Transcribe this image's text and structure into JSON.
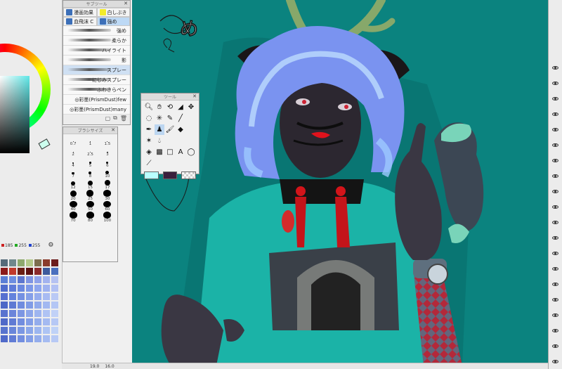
{
  "color_panel": {
    "rgb": {
      "r": "185",
      "g": "255",
      "b": "255"
    },
    "rgb_colors": {
      "r": "#cc2222",
      "g": "#22aa22",
      "b": "#2244cc"
    },
    "palette": [
      "#556b7a",
      "#70888c",
      "#8ea96e",
      "#b4c98b",
      "#7d6e4e",
      "#8a3b2c",
      "#6b1c1c",
      "#8b1a1a",
      "#c0392b",
      "#6a1e14",
      "#5d1111",
      "#8c2a2a",
      "#3e5a9c",
      "#4a6fbe",
      "#5b7fd6",
      "#6e8ee0",
      "#5d77cf",
      "#7f95e3",
      "#8fa2ea",
      "#a3b3ef",
      "#b5c2f2",
      "#4f6ccc",
      "#5f7bd8",
      "#6a88e0",
      "#7d98e8",
      "#8ea6ee",
      "#9fb2f0",
      "#b2c1f4",
      "#5670d0",
      "#6482dc",
      "#7490e2",
      "#859fe8",
      "#96adee",
      "#a8bbf2",
      "#bac9f5",
      "#4d67c7",
      "#5e79d4",
      "#6f8bdf",
      "#809be6",
      "#91aaec",
      "#a2b8f1",
      "#b4c6f5",
      "#5a73cf",
      "#6b85da",
      "#7c96e3",
      "#8da6ea",
      "#9eb5f0",
      "#afc3f4",
      "#c1d1f7",
      "#4f69c8",
      "#607bd4",
      "#718ddf",
      "#829de7",
      "#93acec",
      "#a4baf1",
      "#b6c8f5",
      "#5874ce",
      "#6986da",
      "#7a97e3",
      "#8ba7ea",
      "#9cb6f0",
      "#adc4f4",
      "#bfd2f7",
      "#506ac9",
      "#617cd5",
      "#728ee0",
      "#839ee7",
      "#94adec",
      "#a5bbf1",
      "#b7c9f5"
    ]
  },
  "subtool": {
    "title": "サブツール",
    "tabs_top": [
      {
        "label": "漫画効果",
        "icon": "brush-icon",
        "selected": false
      },
      {
        "label": "白しぶき",
        "icon": "splash-icon",
        "selected": false
      }
    ],
    "tabs_mid": [
      {
        "label": "血飛沫 C",
        "icon": "blood-icon",
        "selected": false
      },
      {
        "label": "強め",
        "icon": "brush-icon",
        "selected": true
      }
    ],
    "brushes": [
      {
        "label": "強め",
        "selected": false
      },
      {
        "label": "柔らか",
        "selected": false
      },
      {
        "label": "ハイライト",
        "selected": false
      },
      {
        "label": "影",
        "selected": false
      },
      {
        "label": "スプレー",
        "selected": true
      },
      {
        "label": "にじみスプレー",
        "selected": false
      },
      {
        "label": "ふわきらペン",
        "selected": false
      },
      {
        "label": "◎彩墨(PrismDust)few",
        "selected": false
      },
      {
        "label": "◎彩墨(PrismDust)many",
        "selected": false
      }
    ]
  },
  "brush_size": {
    "title": "ブラシサイズ",
    "items": [
      {
        "label": "0.7",
        "d": 1
      },
      {
        "label": "1",
        "d": 1
      },
      {
        "label": "1.5",
        "d": 1
      },
      {
        "label": "2",
        "d": 1
      },
      {
        "label": "2.5",
        "d": 1.5
      },
      {
        "label": "3",
        "d": 1.5
      },
      {
        "label": "4",
        "d": 2
      },
      {
        "label": "5",
        "d": 2.5
      },
      {
        "label": "6",
        "d": 3
      },
      {
        "label": "7",
        "d": 3.5
      },
      {
        "label": "8",
        "d": 4
      },
      {
        "label": "10",
        "d": 5
      },
      {
        "label": "12",
        "d": 6
      },
      {
        "label": "15",
        "d": 7
      },
      {
        "label": "17",
        "d": 8
      },
      {
        "label": "20",
        "d": 9
      },
      {
        "label": "25",
        "d": 10
      },
      {
        "label": "30",
        "d": 11
      },
      {
        "label": "40",
        "d": 11
      },
      {
        "label": "50",
        "d": 11
      },
      {
        "label": "60",
        "d": 11
      },
      {
        "label": "70",
        "d": 11
      },
      {
        "label": "80",
        "d": 11
      },
      {
        "label": "100",
        "d": 11
      }
    ]
  },
  "tool": {
    "title": "ツール",
    "icons": [
      {
        "name": "zoom-icon",
        "glyph": "🔍︎"
      },
      {
        "name": "hand-icon",
        "glyph": "✋︎"
      },
      {
        "name": "rotate-icon",
        "glyph": "⟲"
      },
      {
        "name": "select-icon",
        "glyph": "◢"
      },
      {
        "name": "move-icon",
        "glyph": "✥"
      },
      {
        "name": "lasso-icon",
        "glyph": "◌"
      },
      {
        "name": "magic-wand-icon",
        "glyph": "✳"
      },
      {
        "name": "eyedropper-icon",
        "glyph": "✎"
      },
      {
        "name": "eyedropper2-icon",
        "glyph": "╱"
      },
      {
        "name": "blank-icon",
        "glyph": ""
      },
      {
        "name": "pen-icon",
        "glyph": "✒"
      },
      {
        "name": "airbrush-icon",
        "glyph": "♟",
        "selected": true
      },
      {
        "name": "brush-icon",
        "glyph": "🖌︎"
      },
      {
        "name": "fill-icon",
        "glyph": "◆"
      },
      {
        "name": "blank2-icon",
        "glyph": ""
      },
      {
        "name": "blend-icon",
        "glyph": "✶"
      },
      {
        "name": "water-icon",
        "glyph": "💧︎"
      },
      {
        "name": "blank3-icon",
        "glyph": ""
      },
      {
        "name": "blank4-icon",
        "glyph": ""
      },
      {
        "name": "blank5-icon",
        "glyph": ""
      },
      {
        "name": "bucket-icon",
        "glyph": "◈"
      },
      {
        "name": "gradient-icon",
        "glyph": "▩"
      },
      {
        "name": "rectangle-icon",
        "glyph": "□"
      },
      {
        "name": "text-icon",
        "glyph": "A"
      },
      {
        "name": "balloon-icon",
        "glyph": "◯"
      },
      {
        "name": "ruler-icon",
        "glyph": "⟋"
      },
      {
        "name": "blank6-icon",
        "glyph": ""
      },
      {
        "name": "blank7-icon",
        "glyph": ""
      },
      {
        "name": "blank8-icon",
        "glyph": ""
      },
      {
        "name": "blank9-icon",
        "glyph": ""
      }
    ],
    "main_color": "#b9ffff",
    "sub_color": "#3a1f3c"
  },
  "canvas": {
    "background": "#0b837f"
  },
  "status": {
    "zoom": "19.0",
    "angle": "16.0"
  }
}
